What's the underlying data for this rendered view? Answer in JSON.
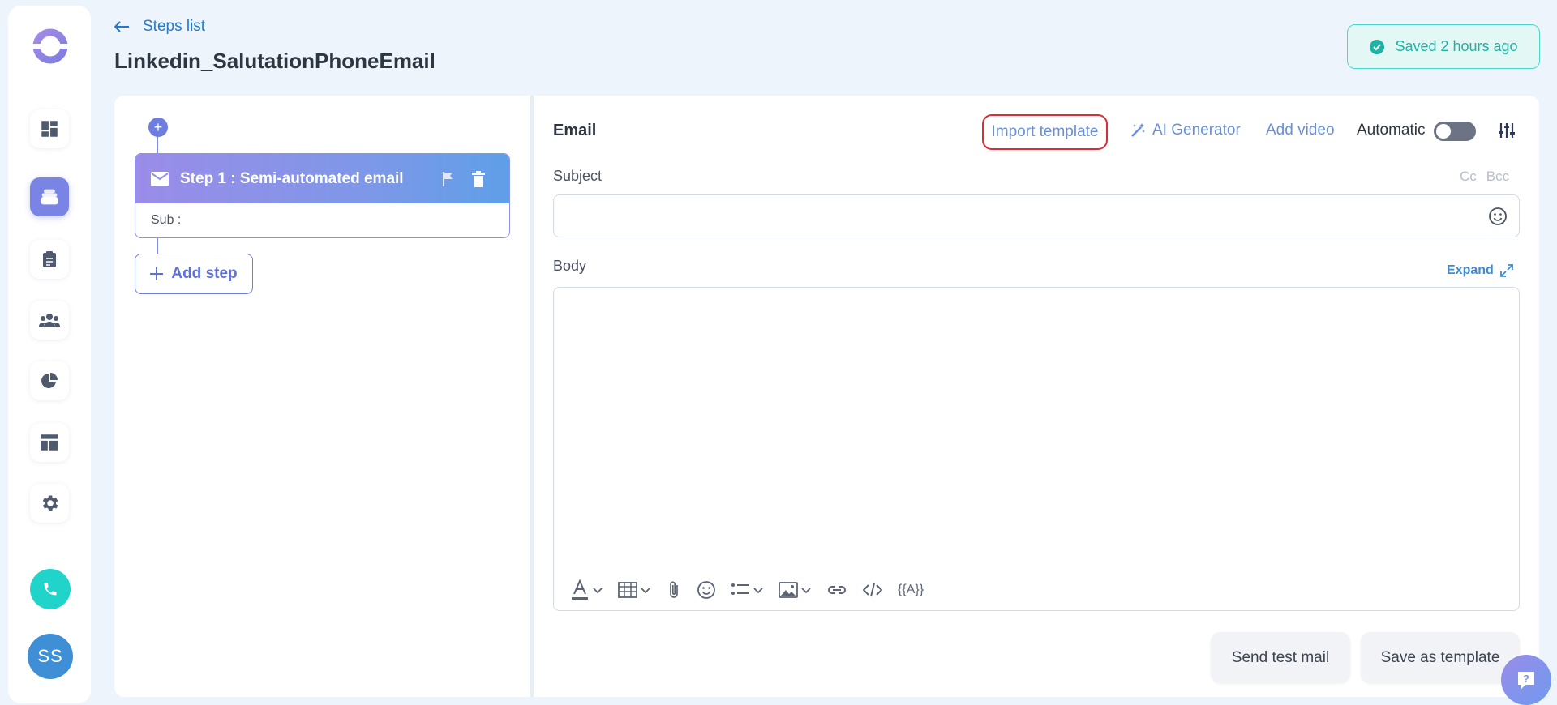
{
  "header": {
    "back_label": "Steps list",
    "title": "Linkedin_SalutationPhoneEmail",
    "saved_status": "Saved 2 hours ago"
  },
  "sidebar": {
    "logo": "brand-logo",
    "items": [
      {
        "name": "dashboard",
        "icon": "dashboard-icon"
      },
      {
        "name": "sequences",
        "icon": "stack-icon",
        "active": true
      },
      {
        "name": "tasks",
        "icon": "clipboard-icon"
      },
      {
        "name": "contacts",
        "icon": "people-icon"
      },
      {
        "name": "reports",
        "icon": "pie-chart-icon"
      },
      {
        "name": "templates",
        "icon": "layout-icon"
      },
      {
        "name": "settings",
        "icon": "gear-icon"
      }
    ],
    "call_icon": "phone-icon",
    "avatar_initials": "SS"
  },
  "steps_panel": {
    "steps": [
      {
        "title": "Step 1 : Semi-automated email",
        "sub_label": "Sub :",
        "icon": "envelope-icon"
      }
    ],
    "add_step_label": "Add step"
  },
  "editor": {
    "type_label": "Email",
    "import_template_label": "Import template",
    "ai_generator_label": "AI Generator",
    "add_video_label": "Add video",
    "automatic_label": "Automatic",
    "automatic_enabled": false,
    "subject_label": "Subject",
    "cc_label": "Cc",
    "bcc_label": "Bcc",
    "subject_value": "",
    "body_label": "Body",
    "expand_label": "Expand",
    "variable_label": "{{A}}",
    "send_test_label": "Send test mail",
    "save_template_label": "Save as template"
  },
  "colors": {
    "accent": "#6d7ee0",
    "link": "#6a8fd7",
    "saved": "#1fb3a6",
    "highlight": "#d92e35"
  }
}
